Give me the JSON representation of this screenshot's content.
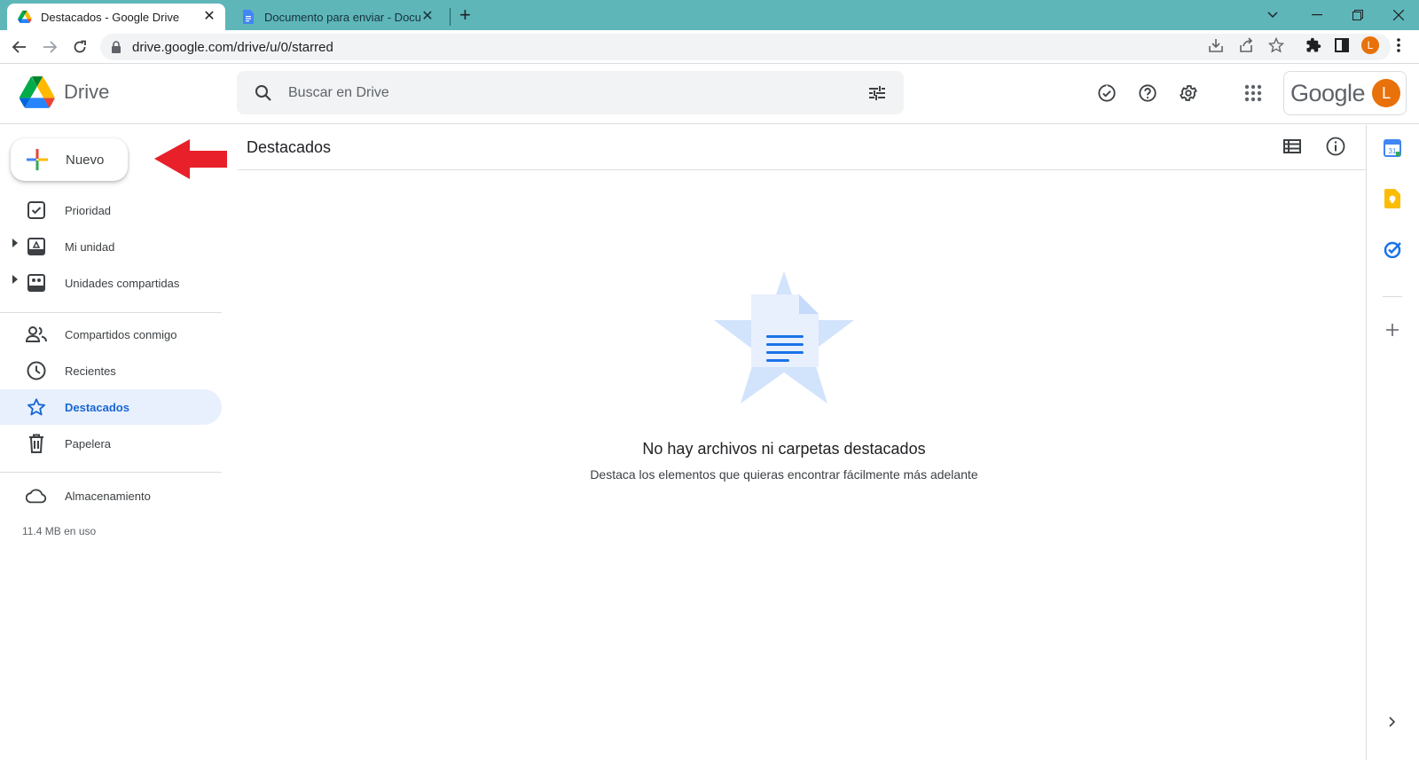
{
  "browser": {
    "tabs": [
      {
        "title": "Destacados - Google Drive",
        "favicon": "google-drive-icon",
        "active": true
      },
      {
        "title": "Documento para enviar - Docum",
        "favicon": "google-docs-icon",
        "active": false
      }
    ],
    "close_glyph": "✕",
    "new_tab_glyph": "+",
    "url": "drive.google.com/drive/u/0/starred",
    "profile_initial": "L"
  },
  "header": {
    "app_name": "Drive",
    "search_placeholder": "Buscar en Drive",
    "google_word": "Google",
    "avatar_initial": "L"
  },
  "sidebar": {
    "new_button_label": "Nuevo",
    "items": [
      {
        "label": "Prioridad",
        "icon": "priority-check-icon"
      },
      {
        "label": "Mi unidad",
        "icon": "my-drive-icon",
        "expandable": true
      },
      {
        "label": "Unidades compartidas",
        "icon": "shared-drives-icon",
        "expandable": true
      },
      {
        "label": "Compartidos conmigo",
        "icon": "people-icon"
      },
      {
        "label": "Recientes",
        "icon": "clock-icon"
      },
      {
        "label": "Destacados",
        "icon": "star-icon",
        "selected": true
      },
      {
        "label": "Papelera",
        "icon": "trash-icon"
      },
      {
        "label": "Almacenamiento",
        "icon": "cloud-icon"
      }
    ],
    "storage_used": "11.4 MB en uso"
  },
  "main": {
    "title": "Destacados",
    "empty_title": "No hay archivos ni carpetas destacados",
    "empty_subtitle": "Destaca los elementos que quieras encontrar fácilmente más adelante"
  },
  "colors": {
    "accent": "#1967d2",
    "selected_bg": "#e8f0fe",
    "tabbar": "#5eb6b9",
    "annotation_arrow": "#e8202a"
  }
}
